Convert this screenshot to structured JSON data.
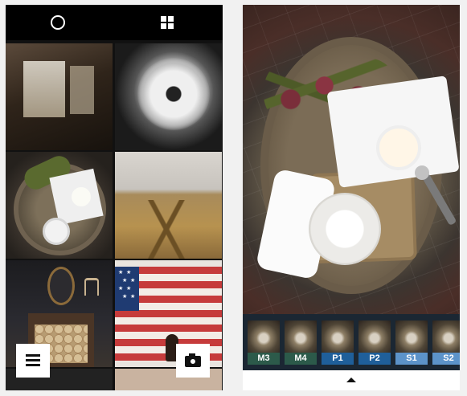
{
  "left_phone": {
    "top_icons": [
      "circle-icon",
      "grid-icon"
    ],
    "bottom_icons": [
      "menu-icon",
      "camera-icon"
    ]
  },
  "right_phone": {
    "filters": [
      {
        "label": "M3",
        "color": "#2c5a4a"
      },
      {
        "label": "M4",
        "color": "#2c5a4a"
      },
      {
        "label": "P1",
        "color": "#1f5f9a"
      },
      {
        "label": "P2",
        "color": "#1f5f9a"
      },
      {
        "label": "S1",
        "color": "#5c93c9"
      },
      {
        "label": "S2",
        "color": "#5c93c9"
      }
    ],
    "bottom_icon": "chevron-up-icon"
  }
}
